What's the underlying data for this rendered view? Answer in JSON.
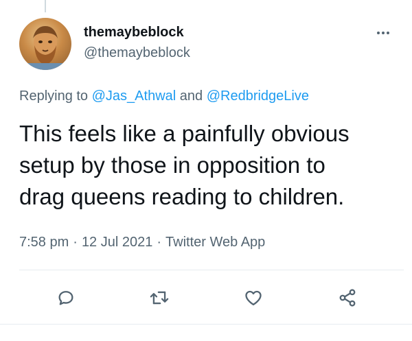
{
  "tweet": {
    "display_name": "themaybeblock",
    "handle": "@themaybeblock",
    "replying_prefix": "Replying to",
    "replying_to": [
      "@Jas_Athwal",
      "@RedbridgeLive"
    ],
    "replying_joiner": "and",
    "text_lines": [
      "This feels like a painfully obvious",
      "setup by those in opposition to",
      "drag queens reading to children."
    ],
    "time": "7:58 pm",
    "date": "12 Jul 2021",
    "source": "Twitter Web App",
    "separator": "·"
  },
  "icons": {
    "more": "more-dots-icon",
    "reply": "reply-icon",
    "retweet": "retweet-icon",
    "like": "like-heart-icon",
    "share": "share-icon"
  },
  "colors": {
    "text": "#0f1419",
    "secondary": "#536471",
    "link": "#1d9bf0",
    "divider": "#e6ecf0"
  }
}
